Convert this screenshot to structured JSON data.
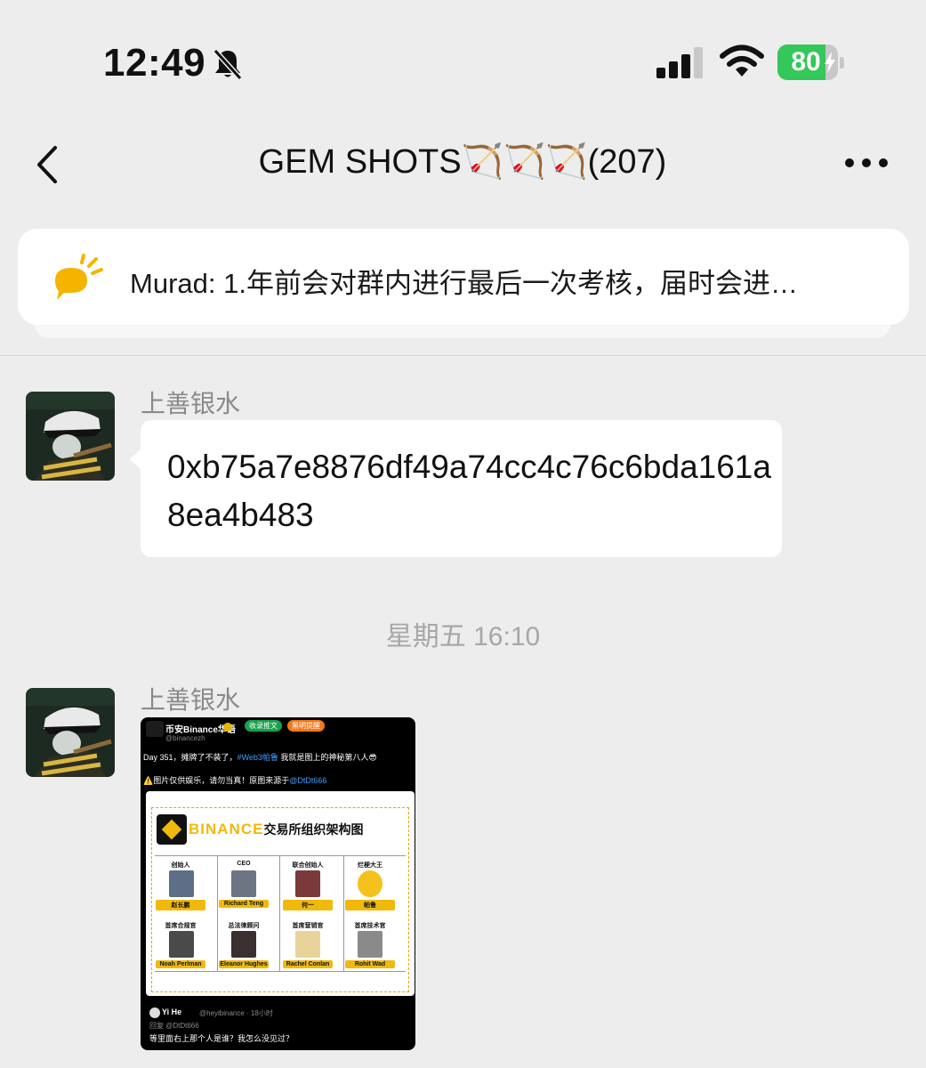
{
  "status_bar": {
    "time": "12:49",
    "battery_percent": "80",
    "battery_level": 0.8,
    "icons": [
      "bell-slash-icon",
      "cellular-signal-icon",
      "wifi-icon",
      "battery-charging-icon"
    ]
  },
  "nav": {
    "title": "GEM SHOTS🏹🏹🏹(207)",
    "back_icon": "chevron-left-icon",
    "more_icon": "ellipsis-icon"
  },
  "notice": {
    "icon": "announcement-icon",
    "text": "Murad: 1.年前会对群内进行最后一次考核，届时会进…"
  },
  "messages": [
    {
      "sender": "上善银水",
      "type": "text",
      "text": "0xb75a7e8876df49a74cc4c76c6bda161a8ea4b483"
    },
    {
      "sender": "上善银水",
      "type": "image"
    }
  ],
  "timestamp": "星期五 16:10",
  "shared_image": {
    "account_name": "币安Binance华语",
    "handle": "@binancezh",
    "pill_follow": "收录推文",
    "pill_alert": "黑明提醒",
    "line1_prefix": "Day 351，摊牌了不装了，",
    "line1_hashtag": "#Web3帕鲁",
    "line1_suffix": " 我就是图上的神秘第八人😎",
    "line2_prefix": "⚠️图片仅供娱乐，请勿当真！原图来源于",
    "line2_link": "@DtDt666",
    "org_brand": "BINANCE",
    "org_title": "交易所组织架构图",
    "roles_top": [
      "创始人",
      "CEO",
      "联合创始人",
      "烂梗大王"
    ],
    "names_top": [
      "赵长鹏",
      "Richard Teng",
      "何一",
      "帕鲁"
    ],
    "roles_bottom": [
      "首席合规官",
      "总法律顾问",
      "首席营销官",
      "首席技术官"
    ],
    "names_bottom": [
      "Noah Perlman",
      "Eleanor Hughes",
      "Rachel Conlan",
      "Rohit Wad"
    ],
    "reply_name": "Yi He",
    "reply_handle": "@heyibinance · 18小时",
    "reply_to": "回复 @DtDt666",
    "reply_text": "等里面右上那个人是谁？我怎么没见过？"
  }
}
